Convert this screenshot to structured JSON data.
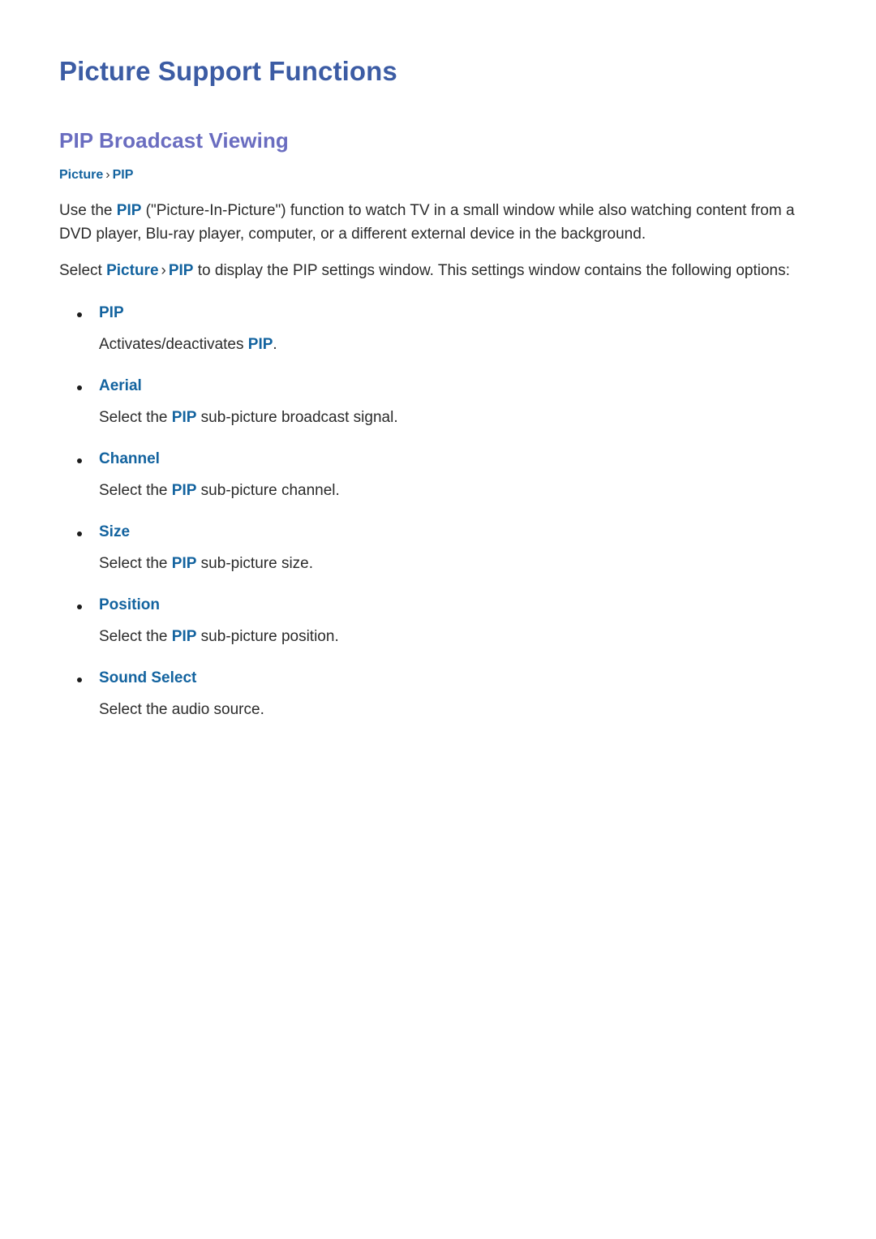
{
  "document": {
    "title": "Picture Support Functions",
    "section_title": "PIP Broadcast Viewing",
    "breadcrumb": {
      "first": "Picture",
      "separator": "›",
      "second": "PIP"
    },
    "paragraphs": {
      "intro": {
        "before_pip": "Use the ",
        "pip": "PIP",
        "after_pip": " (\"Picture-In-Picture\") function to watch TV in a small window while also watching content from a DVD player, Blu-ray player, computer, or a different external device in the background."
      },
      "select": {
        "lead": "Select ",
        "crumb_first": "Picture",
        "crumb_sep": "›",
        "crumb_second": "PIP",
        "tail": " to display the PIP settings window. This settings window contains the following options:"
      }
    },
    "options": [
      {
        "label": "PIP",
        "desc_before": "Activates/deactivates ",
        "desc_hl": "PIP",
        "desc_after": "."
      },
      {
        "label": "Aerial",
        "desc_before": "Select the ",
        "desc_hl": "PIP",
        "desc_after": " sub-picture broadcast signal."
      },
      {
        "label": "Channel",
        "desc_before": "Select the ",
        "desc_hl": "PIP",
        "desc_after": " sub-picture channel."
      },
      {
        "label": "Size",
        "desc_before": "Select the ",
        "desc_hl": "PIP",
        "desc_after": " sub-picture size."
      },
      {
        "label": "Position",
        "desc_before": "Select the ",
        "desc_hl": "PIP",
        "desc_after": " sub-picture position."
      },
      {
        "label": "Sound Select",
        "desc_before": "Select the audio source.",
        "desc_hl": "",
        "desc_after": ""
      }
    ],
    "colors": {
      "page_title": "#3c5ca4",
      "section_title": "#6a6dc0",
      "link_blue": "#13639f",
      "body_text": "#2b2b2b",
      "background": "#ffffff"
    }
  }
}
